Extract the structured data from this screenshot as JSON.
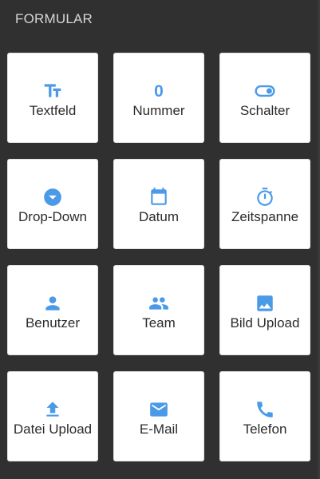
{
  "header": {
    "title": "FORMULAR"
  },
  "accent_color": "#4a9ae8",
  "tiles": [
    {
      "label": "Textfeld",
      "icon": "text-fields-icon"
    },
    {
      "label": "Nummer",
      "icon": "number-icon",
      "glyph": "0"
    },
    {
      "label": "Schalter",
      "icon": "toggle-icon"
    },
    {
      "label": "Drop-Down",
      "icon": "dropdown-icon"
    },
    {
      "label": "Datum",
      "icon": "calendar-icon"
    },
    {
      "label": "Zeitspanne",
      "icon": "timer-icon"
    },
    {
      "label": "Benutzer",
      "icon": "person-icon"
    },
    {
      "label": "Team",
      "icon": "group-icon"
    },
    {
      "label": "Bild Upload",
      "icon": "image-icon"
    },
    {
      "label": "Datei Upload",
      "icon": "upload-icon"
    },
    {
      "label": "E-Mail",
      "icon": "email-icon"
    },
    {
      "label": "Telefon",
      "icon": "phone-icon"
    }
  ]
}
